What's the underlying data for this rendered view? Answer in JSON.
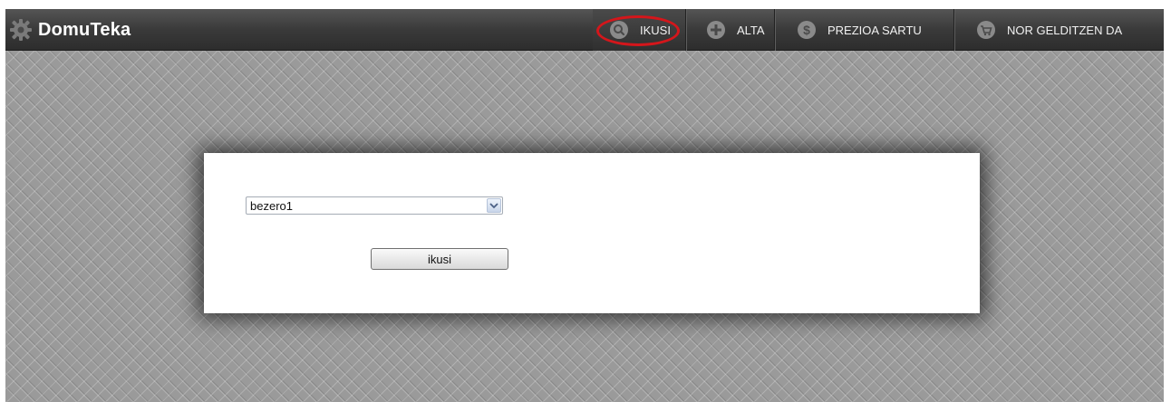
{
  "header": {
    "title": "DomuTeka",
    "logo_icon": "gear-icon"
  },
  "nav": {
    "items": [
      {
        "label": "IKUSI",
        "icon": "search-icon",
        "highlighted": true
      },
      {
        "label": "ALTA",
        "icon": "plus-icon"
      },
      {
        "label": "PREZIOA SARTU",
        "icon": "dollar-icon"
      },
      {
        "label": "NOR GELDITZEN DA",
        "icon": "cart-icon"
      }
    ]
  },
  "form": {
    "select_value": "bezero1",
    "submit_label": "ikusi"
  },
  "colors": {
    "navbar": "#3a3a3a",
    "background": "#9a9a9a",
    "highlight": "#d4161b"
  }
}
